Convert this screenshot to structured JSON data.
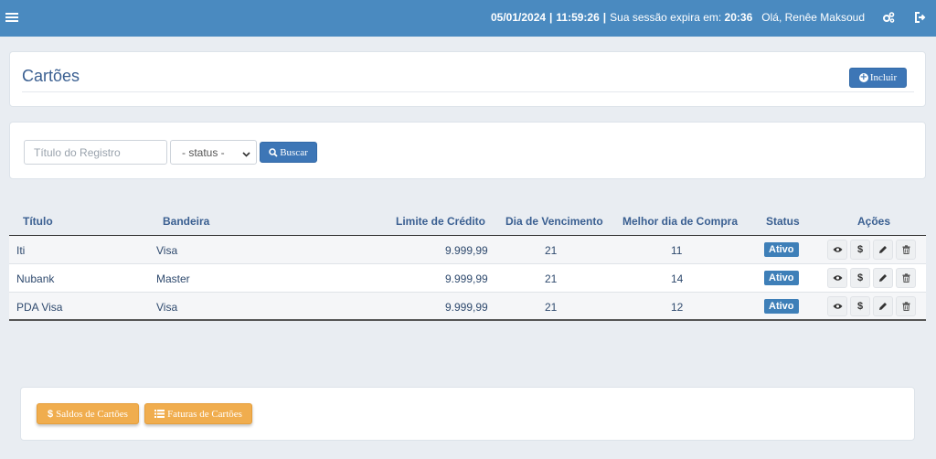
{
  "topbar": {
    "date": "05/01/2024",
    "time": "11:59:26",
    "session_label": "Sua sessão expira em:",
    "session_value": "20:36",
    "greeting": "Olá, Renêe Maksoud"
  },
  "header": {
    "title": "Cartões",
    "include_label": "Incluir"
  },
  "search": {
    "title_placeholder": "Título do Registro",
    "status_selected": "- status -",
    "search_label": "Buscar"
  },
  "table": {
    "columns": [
      "Título",
      "Bandeira",
      "Limite de Crédito",
      "Dia de Vencimento",
      "Melhor dia de Compra",
      "Status",
      "Ações"
    ],
    "rows": [
      {
        "titulo": "Iti",
        "bandeira": "Visa",
        "limite": "9.999,99",
        "vencimento": "21",
        "melhor_dia": "11",
        "status": "Ativo"
      },
      {
        "titulo": "Nubank",
        "bandeira": "Master",
        "limite": "9.999,99",
        "vencimento": "21",
        "melhor_dia": "14",
        "status": "Ativo"
      },
      {
        "titulo": "PDA Visa",
        "bandeira": "Visa",
        "limite": "9.999,99",
        "vencimento": "21",
        "melhor_dia": "12",
        "status": "Ativo"
      }
    ],
    "action_dollar": "$"
  },
  "footer": {
    "saldos_label": "Saldos de Cartões",
    "faturas_label": "Faturas de Cartões",
    "saldos_icon_text": "$"
  },
  "colors": {
    "topbar": "#4a8ac0",
    "primary": "#3d76b6",
    "warning": "#f0ad4e",
    "badge": "#3e7fb8"
  }
}
